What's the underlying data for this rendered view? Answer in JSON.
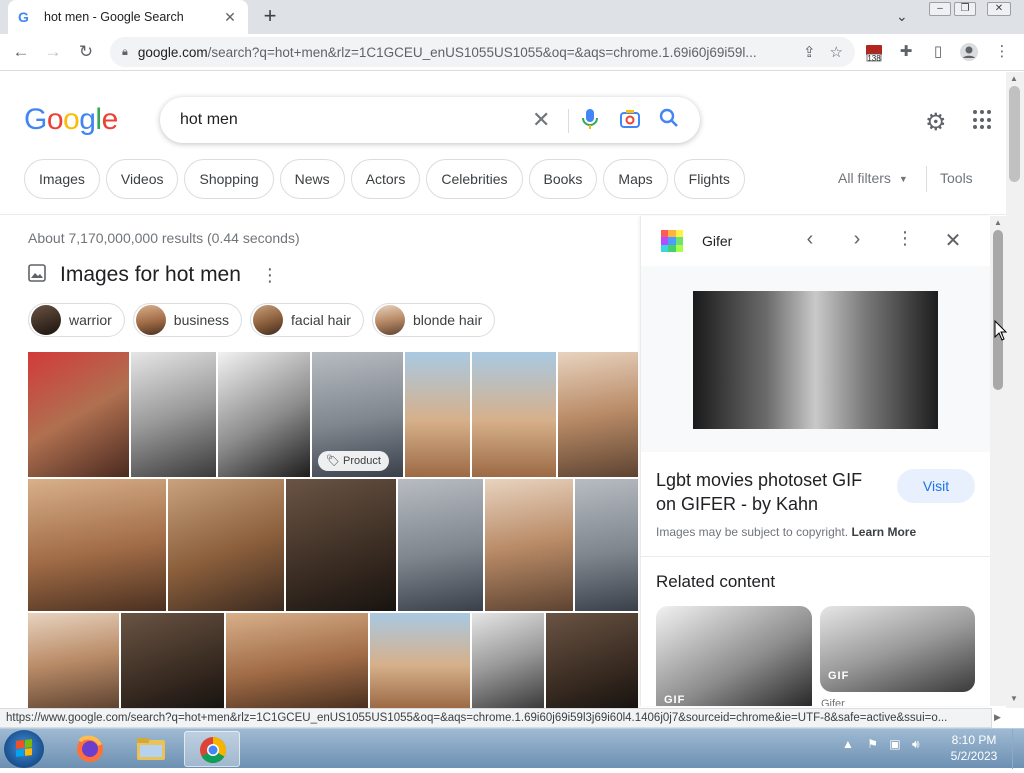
{
  "browser": {
    "tab_title": "hot men - Google Search",
    "tab_favicon": "G",
    "url_host": "google.com",
    "url_rest": "/search?q=hot+men&rlz=1C1GCEU_enUS1055US1055&oq=&aqs=chrome.1.69i60j69i59l...",
    "extension_badge": "138"
  },
  "google": {
    "logo_letters": [
      "G",
      "o",
      "o",
      "g",
      "l",
      "e"
    ],
    "query": "hot men",
    "chips": [
      "Images",
      "Videos",
      "Shopping",
      "News",
      "Actors",
      "Celebrities",
      "Books",
      "Maps",
      "Flights"
    ],
    "all_filters": "All filters",
    "tools": "Tools"
  },
  "results": {
    "stats": "About 7,170,000,000 results (0.44 seconds)",
    "images_title": "Images for hot men",
    "refine_chips": [
      "warrior",
      "business",
      "facial hair",
      "blonde hair"
    ],
    "product_badge": "Product"
  },
  "panel": {
    "source": "Gifer",
    "title": "Lgbt movies photoset GIF on GIFER - by Kahn",
    "visit": "Visit",
    "copyright": "Images may be subject to copyright.",
    "learn_more": "Learn More",
    "related_heading": "Related content",
    "gif_tag": "GIF",
    "related_source": "Gifer"
  },
  "statusbar": {
    "url": "https://www.google.com/search?q=hot+men&rlz=1C1GCEU_enUS1055US1055&oq=&aqs=chrome.1.69i60j69i59l3j69i60l4.1406j0j7&sourceid=chrome&ie=UTF-8&safe=active&ssui=o..."
  },
  "taskbar": {
    "time": "8:10 PM",
    "date": "5/2/2023"
  },
  "colors": {
    "google_blue": "#4285f4",
    "google_red": "#ea4335",
    "google_yellow": "#fbbc05",
    "google_green": "#34a853",
    "link_blue": "#1a73e8"
  }
}
